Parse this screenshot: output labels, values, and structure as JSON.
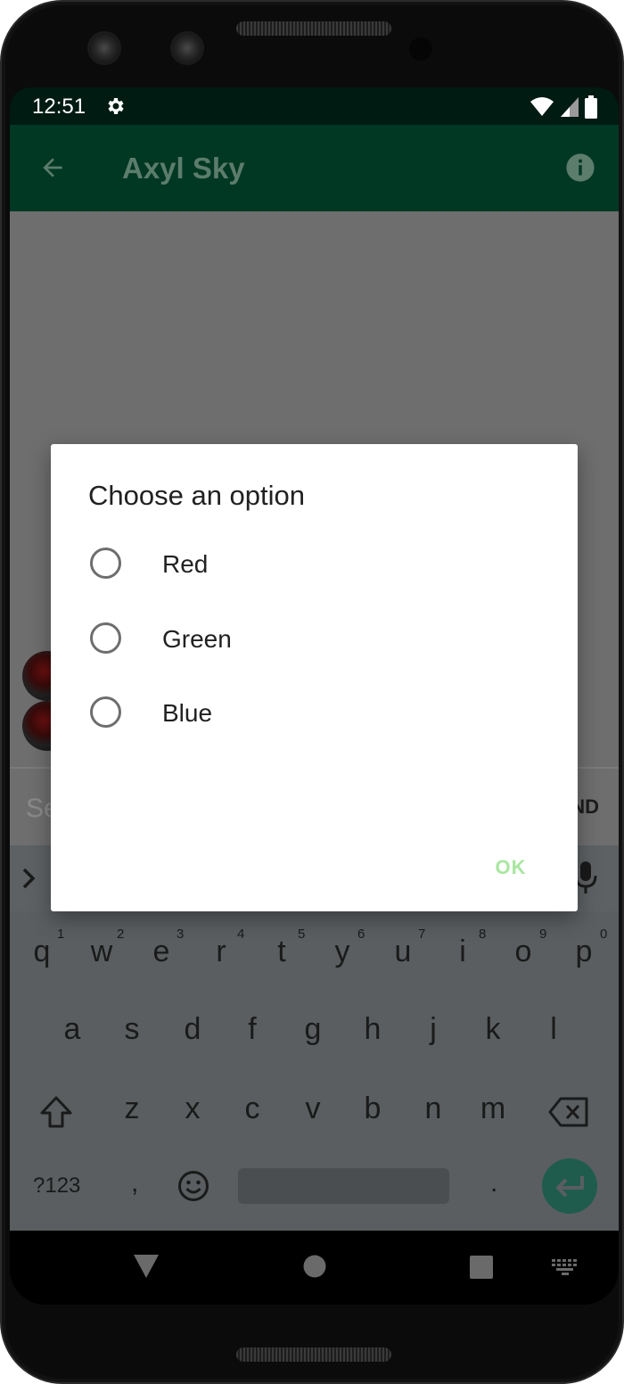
{
  "status_bar": {
    "time": "12:51",
    "icons": [
      "settings-icon",
      "wifi-icon",
      "signal-icon",
      "battery-icon"
    ]
  },
  "app_bar": {
    "title": "Axyl Sky",
    "back_icon": "arrow-back-icon",
    "info_icon": "info-icon",
    "color": "#003824"
  },
  "composer": {
    "placeholder": "Se",
    "send_label": "ND"
  },
  "dialog": {
    "title": "Choose an option",
    "options": [
      {
        "label": "Red",
        "selected": false
      },
      {
        "label": "Green",
        "selected": false
      },
      {
        "label": "Blue",
        "selected": false
      }
    ],
    "ok_label": "OK"
  },
  "keyboard": {
    "row1": [
      {
        "key": "q",
        "num": "1"
      },
      {
        "key": "w",
        "num": "2"
      },
      {
        "key": "e",
        "num": "3"
      },
      {
        "key": "r",
        "num": "4"
      },
      {
        "key": "t",
        "num": "5"
      },
      {
        "key": "y",
        "num": "6"
      },
      {
        "key": "u",
        "num": "7"
      },
      {
        "key": "i",
        "num": "8"
      },
      {
        "key": "o",
        "num": "9"
      },
      {
        "key": "p",
        "num": "0"
      }
    ],
    "row2": [
      "a",
      "s",
      "d",
      "f",
      "g",
      "h",
      "j",
      "k",
      "l"
    ],
    "row3": [
      "z",
      "x",
      "c",
      "v",
      "b",
      "n",
      "m"
    ],
    "symbols_label": "?123",
    "comma": ",",
    "period": "."
  }
}
